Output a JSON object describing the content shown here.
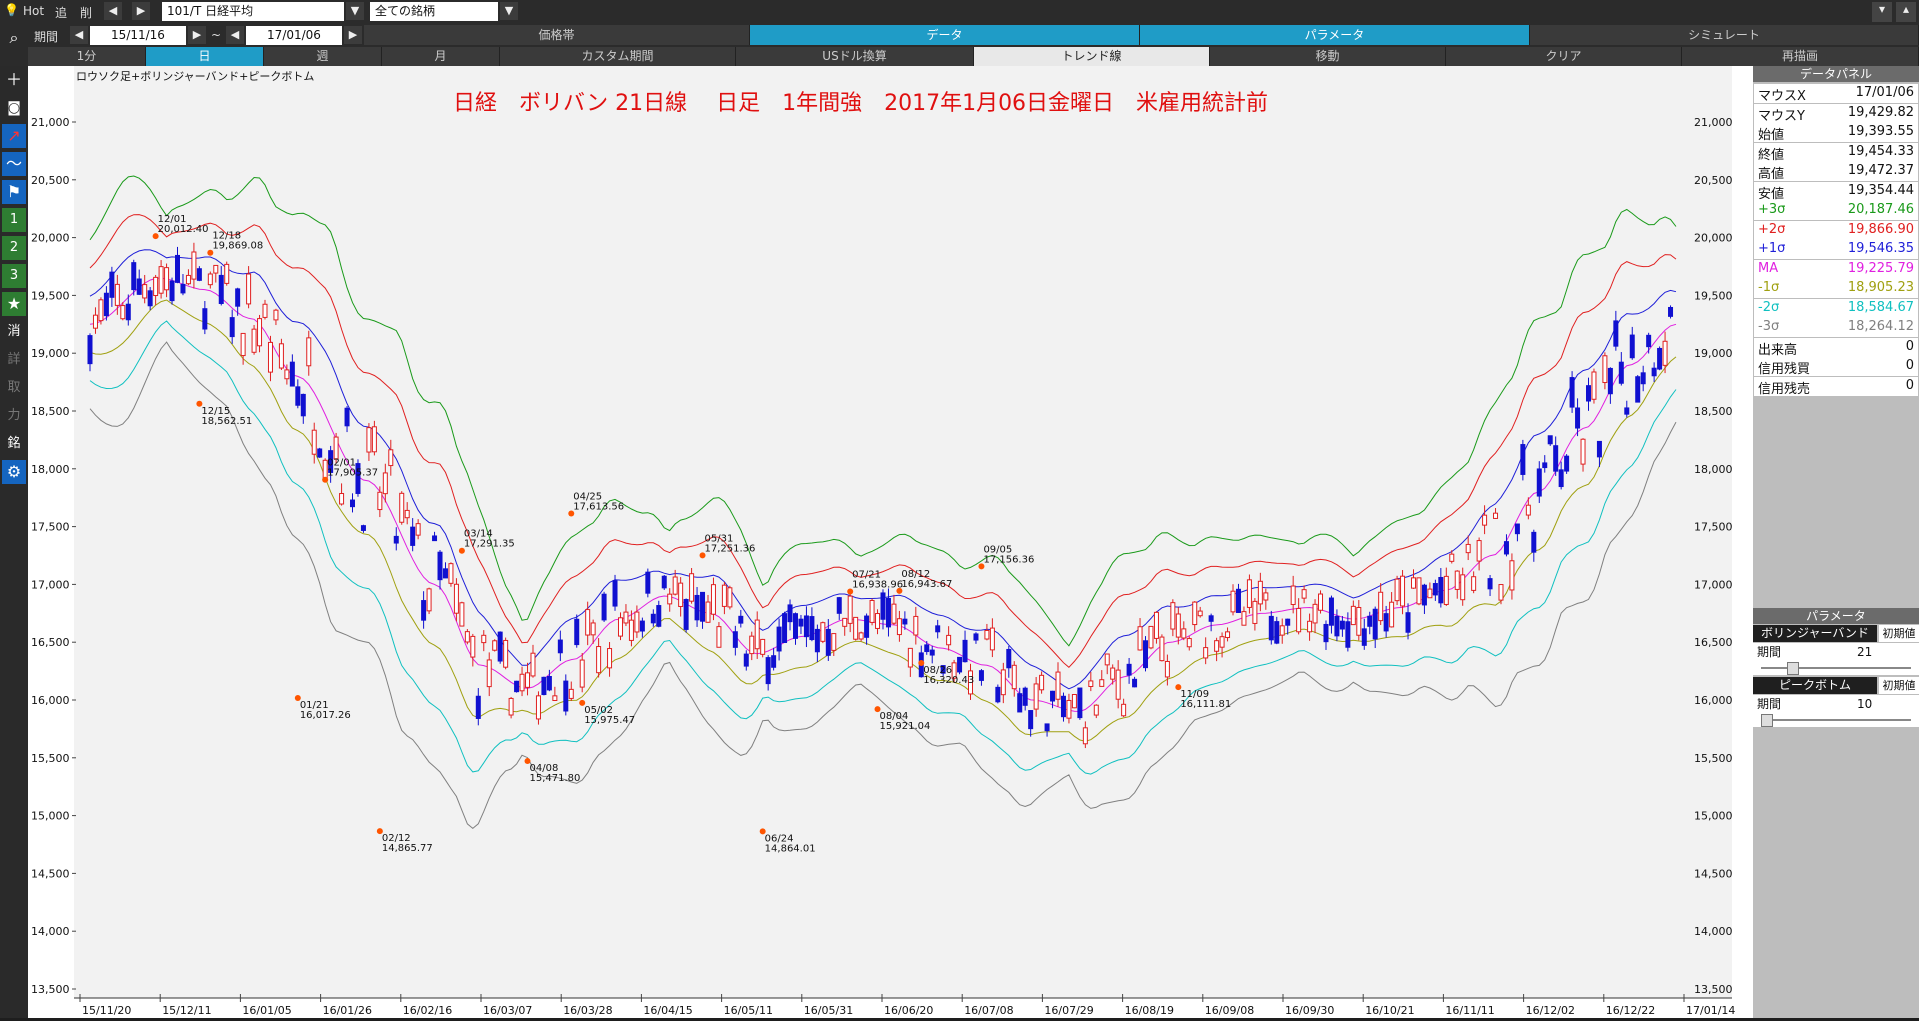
{
  "toolbar": {
    "hot": "Hot",
    "add": "追",
    "del": "削",
    "symbol": "101/T 日経平均",
    "universe": "全ての銘柄",
    "period_label": "期間",
    "date_from": "15/11/16",
    "tilde": "~",
    "date_to": "17/01/06",
    "tabs": [
      "価格帯",
      "データ",
      "パラメータ",
      "シミュレート"
    ],
    "row2": [
      "1分",
      "日",
      "週",
      "月",
      "カスタム期間",
      "USドル換算",
      "トレンド線",
      "移動",
      "クリア",
      "再描画"
    ]
  },
  "sidebar_icons": [
    "search-icon",
    "plus-icon",
    "camera-icon",
    "chart-icon",
    "line-icon",
    "flag-icon",
    "1",
    "2",
    "3",
    "★",
    "消",
    "詳",
    "取",
    "力",
    "銘",
    "gear-icon"
  ],
  "chart_data": {
    "type": "candlestick",
    "subtitle": "ロウソク足+ボリンジャーバンド+ピークボトム",
    "title": "日経　ボリバン 21日線　 日足　1年間強　2017年1月06日金曜日　米雇用統計前",
    "ylim": [
      13500,
      21000
    ],
    "yticks": [
      "21,000",
      "20,500",
      "20,000",
      "19,500",
      "19,000",
      "18,500",
      "18,000",
      "17,500",
      "17,000",
      "16,500",
      "16,000",
      "15,500",
      "15,000",
      "14,500",
      "14,000",
      "13,500"
    ],
    "xticks": [
      "15/11/20",
      "15/12/11",
      "16/01/05",
      "16/01/26",
      "16/02/16",
      "16/03/07",
      "16/03/28",
      "16/04/15",
      "16/05/11",
      "16/05/31",
      "16/06/20",
      "16/07/08",
      "16/07/29",
      "16/08/19",
      "16/09/08",
      "16/09/30",
      "16/10/21",
      "16/11/11",
      "16/12/02",
      "16/12/22",
      "17/01/14"
    ],
    "series_colors": {
      "plus3": "#1a9a1a",
      "plus2": "#e02020",
      "plus1": "#1f1fd8",
      "ma": "#e020e0",
      "minus1": "#a0a010",
      "minus2": "#10c0c0",
      "minus3": "#808080"
    },
    "peaks": [
      {
        "date": "12/01",
        "value": "20,012.40",
        "x": 0.0,
        "y": 20012.4,
        "pos": "above"
      },
      {
        "date": "12/18",
        "value": "19,869.08",
        "x": 0.0,
        "y": 19869.08,
        "pos": "above"
      },
      {
        "date": "12/15",
        "value": "18,562.51",
        "x": 0.0,
        "y": 18562.51,
        "pos": "below"
      },
      {
        "date": "02/01",
        "value": "17,905.37",
        "x": 0.0,
        "y": 17905.37,
        "pos": "above"
      },
      {
        "date": "01/21",
        "value": "16,017.26",
        "x": 0.0,
        "y": 16017.26,
        "pos": "below"
      },
      {
        "date": "02/12",
        "value": "14,865.77",
        "x": 0.0,
        "y": 14865.77,
        "pos": "below"
      },
      {
        "date": "03/14",
        "value": "17,291.35",
        "x": 0.0,
        "y": 17291.35,
        "pos": "above"
      },
      {
        "date": "04/08",
        "value": "15,471.80",
        "x": 0.0,
        "y": 15471.8,
        "pos": "below"
      },
      {
        "date": "04/25",
        "value": "17,613.56",
        "x": 0.0,
        "y": 17613.56,
        "pos": "above"
      },
      {
        "date": "05/02",
        "value": "15,975.47",
        "x": 0.0,
        "y": 15975.47,
        "pos": "below"
      },
      {
        "date": "05/31",
        "value": "17,251.36",
        "x": 0.0,
        "y": 17251.36,
        "pos": "above"
      },
      {
        "date": "06/24",
        "value": "14,864.01",
        "x": 0.0,
        "y": 14864.01,
        "pos": "below"
      },
      {
        "date": "07/21",
        "value": "16,938.96",
        "x": 0.0,
        "y": 16938.96,
        "pos": "above"
      },
      {
        "date": "08/04",
        "value": "15,921.04",
        "x": 0.0,
        "y": 15921.04,
        "pos": "below"
      },
      {
        "date": "08/12",
        "value": "16,943.67",
        "x": 0.0,
        "y": 16943.67,
        "pos": "above"
      },
      {
        "date": "08/26",
        "value": "16,320.43",
        "x": 0.0,
        "y": 16320.43,
        "pos": "below"
      },
      {
        "date": "09/05",
        "value": "17,156.36",
        "x": 0.0,
        "y": 17156.36,
        "pos": "above"
      },
      {
        "date": "11/09",
        "value": "16,111.81",
        "x": 0.0,
        "y": 16111.81,
        "pos": "below"
      }
    ]
  },
  "data_panel": {
    "header": "データパネル",
    "rows": [
      {
        "k": "マウスX",
        "v": "17/01/06",
        "c": "#111"
      },
      {
        "k": "マウスY",
        "v": "19,429.82",
        "c": "#111"
      },
      {
        "k": "始値",
        "v": "19,393.55",
        "c": "#111"
      },
      {
        "k": "終値",
        "v": "19,454.33",
        "c": "#111"
      },
      {
        "k": "高値",
        "v": "19,472.37",
        "c": "#111"
      },
      {
        "k": "安値",
        "v": "19,354.44",
        "c": "#111"
      },
      {
        "k": "+3σ",
        "v": "20,187.46",
        "c": "#1a9a1a"
      },
      {
        "k": "+2σ",
        "v": "19,866.90",
        "c": "#e02020"
      },
      {
        "k": "+1σ",
        "v": "19,546.35",
        "c": "#1f1fd8"
      },
      {
        "k": "MA",
        "v": "19,225.79",
        "c": "#e020e0"
      },
      {
        "k": "-1σ",
        "v": "18,905.23",
        "c": "#a0a010"
      },
      {
        "k": "-2σ",
        "v": "18,584.67",
        "c": "#10c0c0"
      },
      {
        "k": "-3σ",
        "v": "18,264.12",
        "c": "#808080"
      },
      {
        "k": "出来高",
        "v": "0",
        "c": "#111"
      },
      {
        "k": "信用残買",
        "v": "0",
        "c": "#111"
      },
      {
        "k": "信用残売",
        "v": "0",
        "c": "#111"
      }
    ]
  },
  "param_panel": {
    "header": "パラメータ",
    "boll_label": "ボリンジャーバンド",
    "reset": "初期値",
    "period_label": "期間",
    "boll_period": "21",
    "peak_label": "ピークボトム",
    "peak_period": "10"
  }
}
